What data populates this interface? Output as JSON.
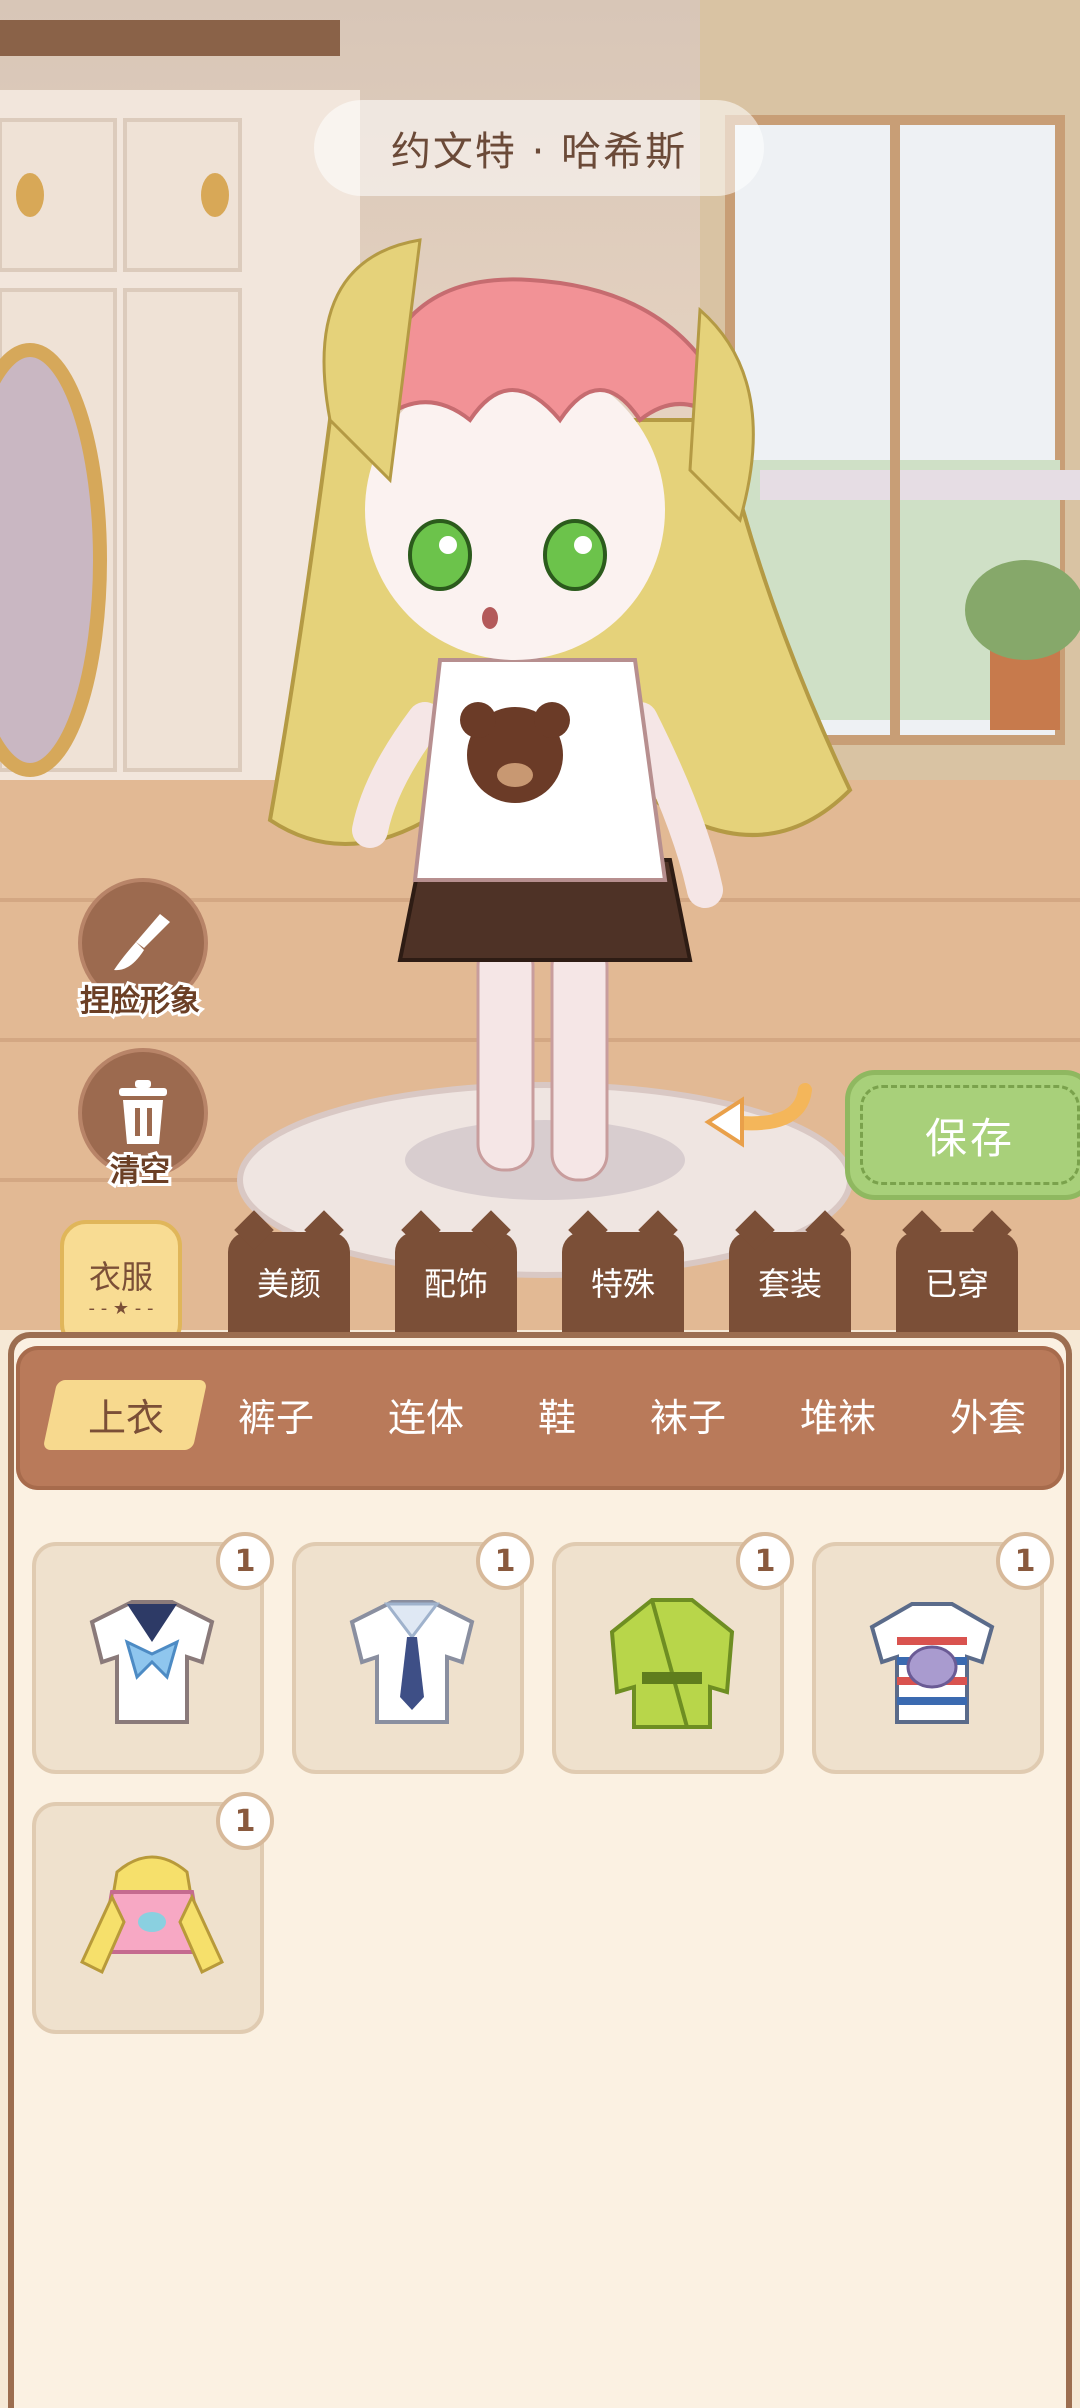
{
  "header": {
    "character_name": "约文特 · 哈希斯"
  },
  "side_buttons": {
    "face_label": "捏脸形象",
    "clear_label": "清空"
  },
  "save_label": "保存",
  "main_tabs": [
    {
      "label": "衣服",
      "active": true
    },
    {
      "label": "美颜"
    },
    {
      "label": "配饰"
    },
    {
      "label": "特殊"
    },
    {
      "label": "套装"
    },
    {
      "label": "已穿"
    }
  ],
  "sub_tabs": [
    {
      "label": "上衣",
      "active": true
    },
    {
      "label": "裤子"
    },
    {
      "label": "连体"
    },
    {
      "label": "鞋"
    },
    {
      "label": "袜子"
    },
    {
      "label": "堆袜"
    },
    {
      "label": "外套"
    }
  ],
  "items": [
    {
      "count": "1",
      "icon": "sailor-shirt-blue-bow-icon"
    },
    {
      "count": "1",
      "icon": "sailor-shirt-tie-icon"
    },
    {
      "count": "1",
      "icon": "green-robe-icon"
    },
    {
      "count": "1",
      "icon": "striped-cat-tshirt-icon"
    },
    {
      "count": "1",
      "icon": "pink-hoodie-icon"
    }
  ],
  "colors": {
    "accent_brown": "#7b4f37",
    "save_green": "#a8d07a",
    "highlight_yellow": "#f7d98e"
  }
}
